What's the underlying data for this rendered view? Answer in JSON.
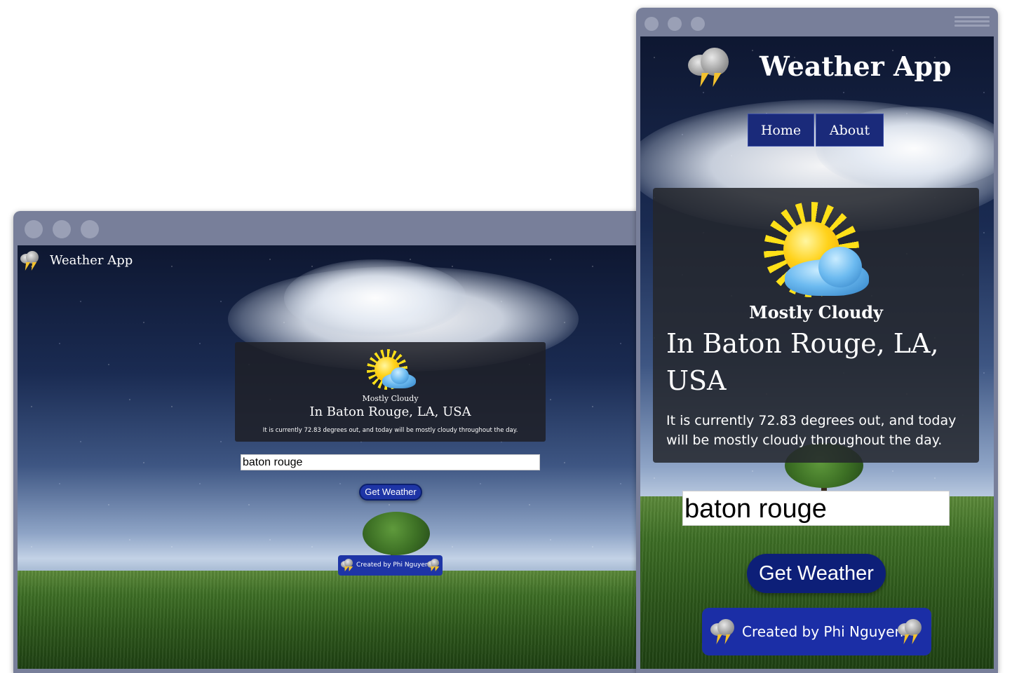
{
  "app": {
    "title": "Weather App",
    "brand_icon": "thunderstorm-cloud-icon"
  },
  "nav": {
    "items": [
      {
        "label": "Home"
      },
      {
        "label": "About"
      }
    ]
  },
  "weather": {
    "icon": "sun-behind-cloud-icon",
    "condition": "Mostly Cloudy",
    "location": "In Baton Rouge, LA, USA",
    "description": "It is currently 72.83 degrees out, and today will be mostly cloudy throughout the day."
  },
  "search": {
    "value": "baton rouge"
  },
  "actions": {
    "get_weather_label": "Get Weather"
  },
  "footer": {
    "credit": "Created by Phi Nguyen",
    "credit_icon": "thunderstorm-cloud-icon"
  },
  "colors": {
    "frame": "#787f9a",
    "button_blue": "#1e35a6",
    "card_dark": "#24262c"
  }
}
